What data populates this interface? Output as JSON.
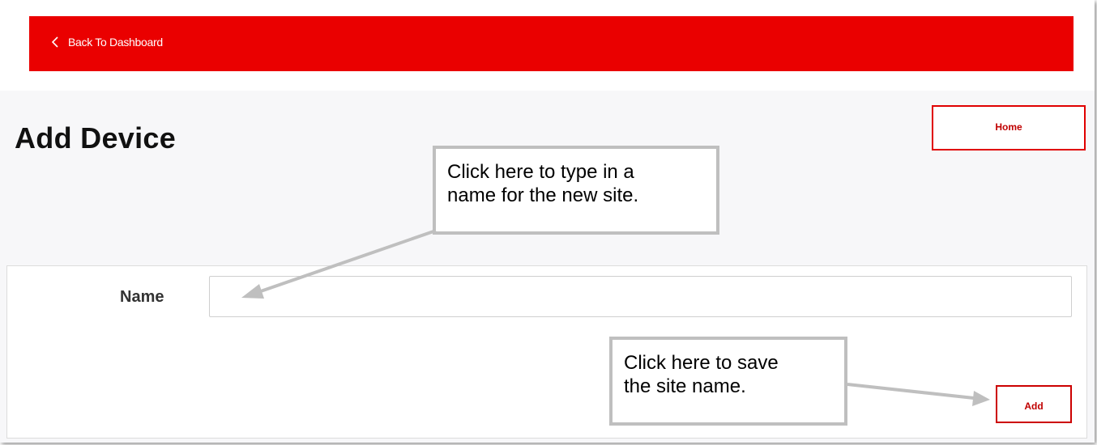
{
  "topbar": {
    "back_label": "Back To Dashboard",
    "background_color": "#ea0000"
  },
  "page": {
    "title": "Add Device",
    "home_button_label": "Home"
  },
  "form": {
    "name_label": "Name",
    "name_value": "",
    "add_button_label": "Add"
  },
  "callouts": [
    {
      "lines": [
        "Click here to type in a",
        "name for the new site."
      ]
    },
    {
      "lines": [
        "Click here to save",
        "the site name."
      ]
    }
  ],
  "icons": {
    "back": "chevron-left-icon"
  },
  "colors": {
    "accent": "#ea0000",
    "button_border": "#e00000",
    "button_text": "#c00000",
    "page_background": "#f7f7f9",
    "callout_border": "#bfbfbf"
  }
}
